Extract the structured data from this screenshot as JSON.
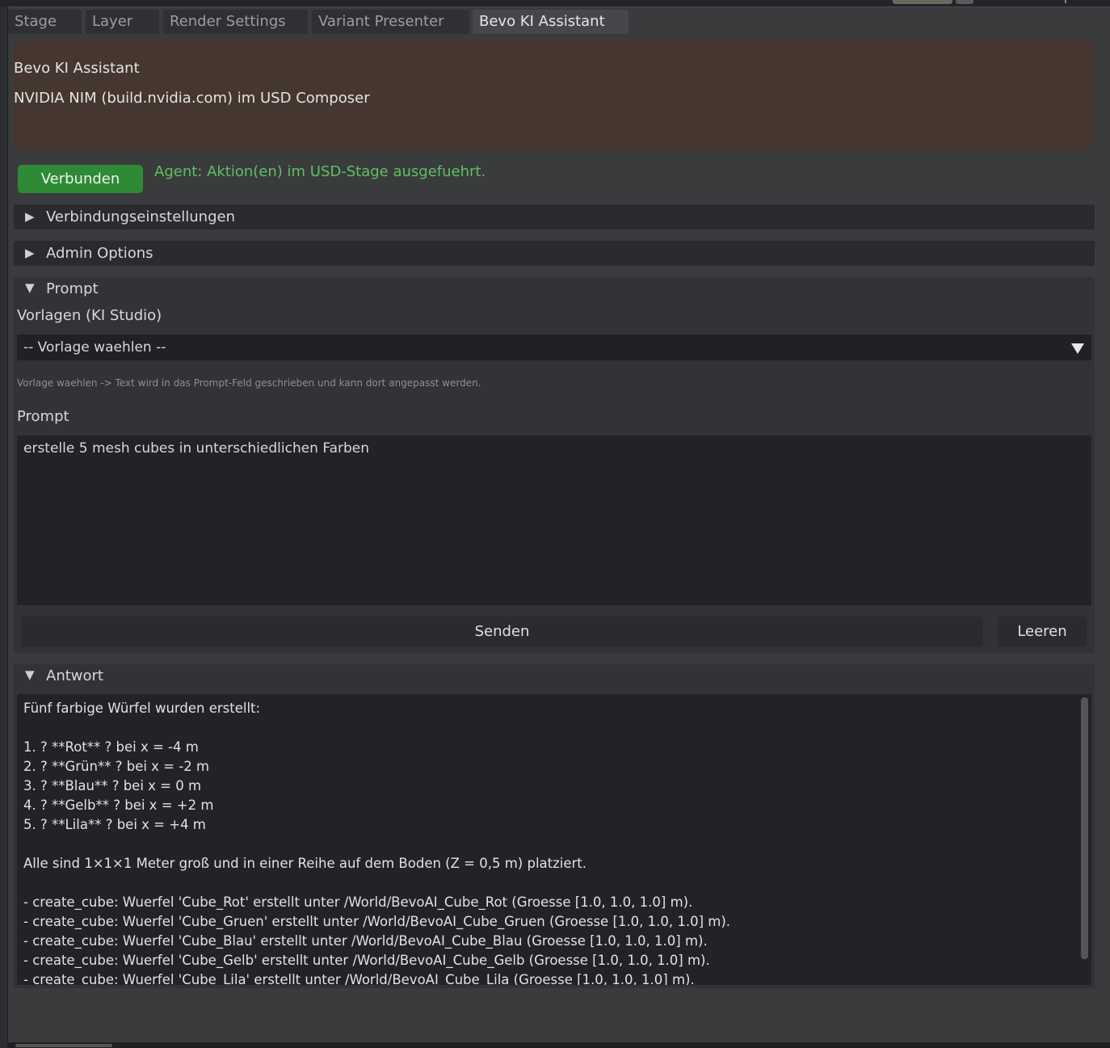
{
  "tabs": [
    {
      "label": "Stage"
    },
    {
      "label": "Layer"
    },
    {
      "label": "Render Settings"
    },
    {
      "label": "Variant Presenter"
    },
    {
      "label": "Bevo KI Assistant"
    }
  ],
  "active_tab": "Bevo KI Assistant",
  "header": {
    "title": "Bevo KI Assistant",
    "subtitle": "NVIDIA NIM (build.nvidia.com) im USD Composer"
  },
  "status": {
    "button_label": "Verbunden",
    "message": "Agent: Aktion(en) im USD-Stage ausgefuehrt."
  },
  "sections": {
    "connection": {
      "label": "Verbindungseinstellungen",
      "expanded": false
    },
    "admin": {
      "label": "Admin Options",
      "expanded": false
    },
    "prompt": {
      "label": "Prompt",
      "expanded": true
    },
    "answer": {
      "label": "Antwort",
      "expanded": true
    }
  },
  "prompt": {
    "templates_label": "Vorlagen (KI Studio)",
    "template_selected": "-- Vorlage waehlen --",
    "hint": "Vorlage waehlen -> Text wird in das Prompt-Feld geschrieben und kann dort angepasst werden.",
    "field_label": "Prompt",
    "value": "erstelle 5 mesh cubes in unterschiedlichen Farben",
    "send_label": "Senden",
    "clear_label": "Leeren"
  },
  "answer": {
    "lines": [
      "Fünf farbige Würfel wurden erstellt:",
      "",
      "1. ? **Rot** ? bei x = -4 m",
      "2. ? **Grün** ? bei x = -2 m",
      "3. ? **Blau** ? bei x = 0 m",
      "4. ? **Gelb** ? bei x = +2 m",
      "5. ? **Lila** ? bei x = +4 m",
      "",
      "Alle sind 1×1×1 Meter groß und in einer Reihe auf dem Boden (Z = 0,5 m) platziert.",
      "",
      "- create_cube: Wuerfel 'Cube_Rot' erstellt unter /World/BevoAI_Cube_Rot (Groesse [1.0, 1.0, 1.0] m).",
      "- create_cube: Wuerfel 'Cube_Gruen' erstellt unter /World/BevoAI_Cube_Gruen (Groesse [1.0, 1.0, 1.0] m).",
      "- create_cube: Wuerfel 'Cube_Blau' erstellt unter /World/BevoAI_Cube_Blau (Groesse [1.0, 1.0, 1.0] m).",
      "- create_cube: Wuerfel 'Cube_Gelb' erstellt unter /World/BevoAI_Cube_Gelb (Groesse [1.0, 1.0, 1.0] m).",
      "- create_cube: Wuerfel 'Cube_Lila' erstellt unter /World/BevoAI_Cube_Lila (Groesse [1.0, 1.0, 1.0] m)."
    ]
  },
  "colors": {
    "status_green": "#2f8a36",
    "status_text_green": "#5cc160",
    "header_brown": "#45362f"
  }
}
